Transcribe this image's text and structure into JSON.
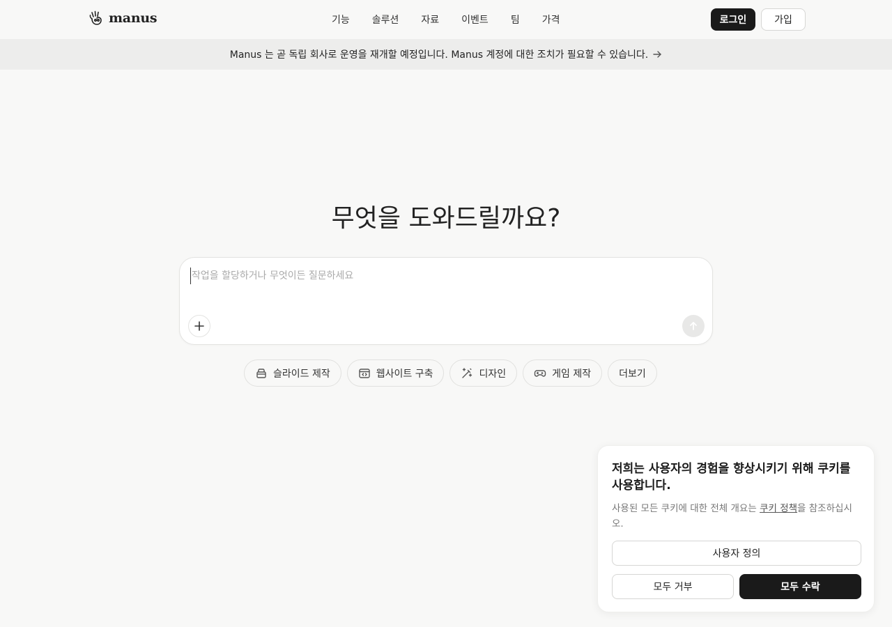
{
  "header": {
    "logo_text": "manus",
    "logo_icon": "manus-hand-icon",
    "nav": [
      {
        "label": "기능"
      },
      {
        "label": "솔루션"
      },
      {
        "label": "자료"
      },
      {
        "label": "이벤트"
      },
      {
        "label": "팀"
      },
      {
        "label": "가격"
      }
    ],
    "login_label": "로그인",
    "signup_label": "가입"
  },
  "banner": {
    "text": "Manus 는 곧 독립 회사로 운영을 재개할 예정입니다. Manus 계정에 대한 조치가 필요할 수 있습니다.",
    "icon": "arrow-right-icon"
  },
  "main": {
    "heading": "무엇을 도와드릴까요?",
    "input": {
      "value": "",
      "placeholder": "작업을 할당하거나 무엇이든 질문하세요"
    },
    "add_icon": "plus-icon",
    "send_icon": "arrow-up-icon",
    "chips": [
      {
        "label": "슬라이드 제작",
        "icon": "slides-icon"
      },
      {
        "label": "웹사이트 구축",
        "icon": "code-window-icon"
      },
      {
        "label": "디자인",
        "icon": "magic-wand-icon"
      },
      {
        "label": "게임 제작",
        "icon": "gamepad-icon"
      },
      {
        "label": "더보기"
      }
    ]
  },
  "cookie": {
    "title": "저희는 사용자의 경험을 향상시키기 위해 쿠키를 사용합니다.",
    "body_before": "사용된 모든 쿠키에 대한 전체 개요는 ",
    "link_label": "쿠키 정책",
    "body_after": "을 참조하십시오.",
    "customize_label": "사용자 정의",
    "reject_label": "모두 거부",
    "accept_label": "모두 수락"
  },
  "colors": {
    "background": "#f8f8f7",
    "banner_background": "#ededec",
    "primary_button": "#1a1a1a"
  }
}
